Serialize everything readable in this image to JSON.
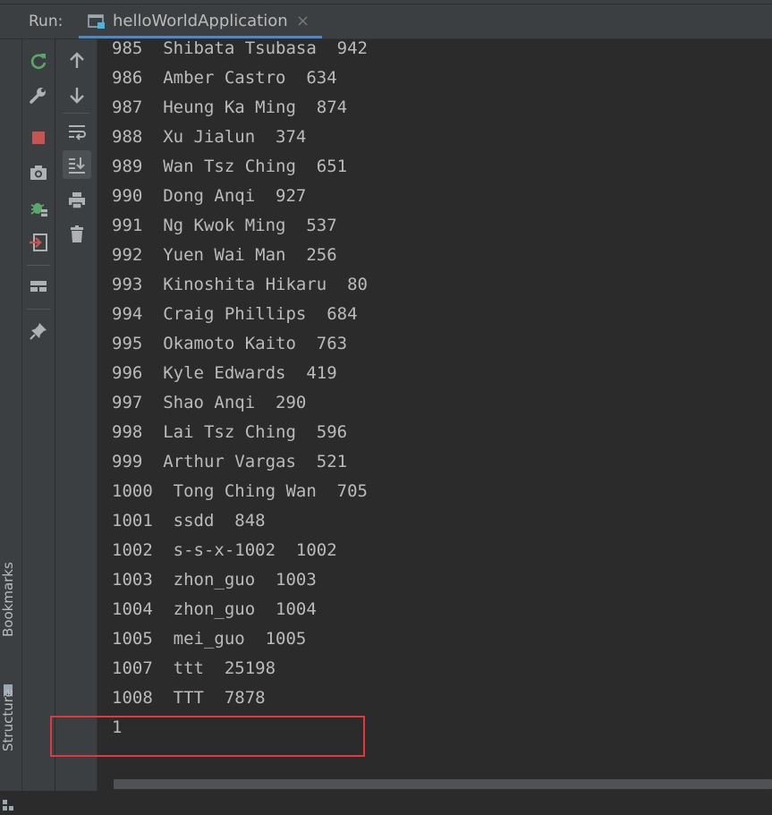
{
  "runbar": {
    "label": "Run:",
    "tab_title": "helloWorldApplication",
    "tab_close": "×"
  },
  "side_stripe": {
    "bookmarks": "Bookmarks",
    "structure": "Structure"
  },
  "toolbar_left": [
    "rerun-icon",
    "wrench-icon",
    "stop-icon",
    "camera-icon",
    "debug-icon",
    "exit-icon",
    "layout-icon",
    "pin-icon"
  ],
  "toolbar_right": [
    "up-arrow-icon",
    "down-arrow-icon",
    "soft-wrap-icon",
    "scroll-to-end-icon",
    "print-icon",
    "trash-icon"
  ],
  "colors": {
    "background": "#2b2b2b",
    "panel": "#3c3f41",
    "text": "#bbbbbb",
    "stop_red": "#c75450",
    "rerun_green": "#59a869",
    "highlight_border": "#e0383e"
  },
  "console": {
    "lines": [
      "985  Shibata Tsubasa  942",
      "986  Amber Castro  634",
      "987  Heung Ka Ming  874",
      "988  Xu Jialun  374",
      "989  Wan Tsz Ching  651",
      "990  Dong Anqi  927",
      "991  Ng Kwok Ming  537",
      "992  Yuen Wai Man  256",
      "993  Kinoshita Hikaru  80",
      "994  Craig Phillips  684",
      "995  Okamoto Kaito  763",
      "996  Kyle Edwards  419",
      "997  Shao Anqi  290",
      "998  Lai Tsz Ching  596",
      "999  Arthur Vargas  521",
      "1000  Tong Ching Wan  705",
      "1001  ssdd  848",
      "1002  s-s-x-1002  1002",
      "1003  zhon_guo  1003",
      "1004  zhon_guo  1004",
      "1005  mei_guo  1005",
      "1007  ttt  25198",
      "1008  TTT  7878",
      "1"
    ]
  }
}
